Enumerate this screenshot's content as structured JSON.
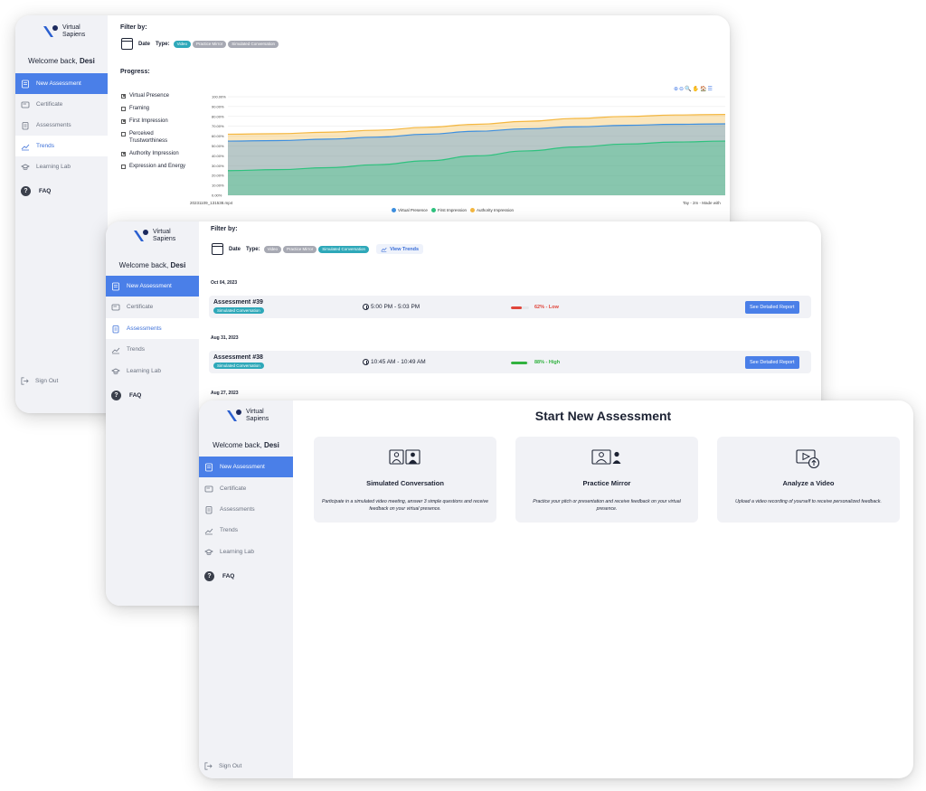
{
  "brand": {
    "line1": "Virtual",
    "line2": "Sapiens"
  },
  "welcome": {
    "prefix": "Welcome back,",
    "name": "Desi"
  },
  "nav": {
    "new_assessment": "New Assessment",
    "certificate": "Certificate",
    "assessments": "Assessments",
    "trends": "Trends",
    "learning_lab": "Learning Lab",
    "faq": "FAQ",
    "sign_out": "Sign Out"
  },
  "filter": {
    "label": "Filter by:",
    "date": "Date",
    "type": "Type:",
    "chips": [
      "Video",
      "Practice Mirror",
      "Simulated Conversation"
    ],
    "view_trends": "View Trends"
  },
  "trends": {
    "progress_label": "Progress:",
    "checklist": [
      {
        "label": "Virtual Presence",
        "checked": true
      },
      {
        "label": "Framing",
        "checked": false
      },
      {
        "label": "First Impression",
        "checked": true
      },
      {
        "label": "Perceived Trustworthiness",
        "checked": false
      },
      {
        "label": "Authority Impression",
        "checked": true
      },
      {
        "label": "Expression and Energy",
        "checked": false
      }
    ],
    "x_label_left": "20231109_131538.mp4",
    "x_label_right": "Tay - 2m - Made with",
    "toolbar_glyphs": "⊕⊖🔍✋🏠☰"
  },
  "chart_data": {
    "type": "area",
    "ylim": [
      0,
      100
    ],
    "yticks": [
      "100.00%",
      "90.00%",
      "80.00%",
      "70.00%",
      "60.00%",
      "50.00%",
      "40.00%",
      "30.00%",
      "20.00%",
      "10.00%",
      "0.00%"
    ],
    "x": [
      0,
      1,
      2,
      3,
      4,
      5,
      6,
      7,
      8,
      9,
      10
    ],
    "series": [
      {
        "name": "Virtual Presence",
        "color": "#3d8fe0",
        "values": [
          55,
          55.5,
          57,
          59,
          62,
          65,
          67.5,
          69.5,
          71,
          72,
          72.5
        ]
      },
      {
        "name": "First Impression",
        "color": "#2ec27e",
        "values": [
          25,
          26,
          28,
          31,
          35,
          40,
          45,
          49,
          52,
          54,
          55
        ]
      },
      {
        "name": "Authority Impression",
        "color": "#f4b740",
        "values": [
          62,
          62.5,
          64,
          66,
          69,
          72,
          75,
          78,
          80,
          81.5,
          82
        ]
      }
    ]
  },
  "assessments": [
    {
      "date": "Oct 04, 2023",
      "title": "Assessment #39",
      "type": "Simulated Conversation",
      "time": "5:00 PM - 5:03 PM",
      "score": "62% - Low",
      "score_pct": 62,
      "score_color": "#e0453a",
      "button": "See Detailed Report"
    },
    {
      "date": "Aug 31, 2023",
      "title": "Assessment #38",
      "type": "Simulated Conversation",
      "time": "10:45 AM - 10:49 AM",
      "score": "88% - High",
      "score_pct": 88,
      "score_color": "#31b23f",
      "button": "See Detailed Report"
    },
    {
      "date": "Aug 27, 2023"
    }
  ],
  "start": {
    "title": "Start New Assessment",
    "cards": [
      {
        "icon": "simulated-conversation-icon",
        "title": "Simulated Conversation",
        "desc": "Participate in a simulated video meeting, answer 3 simple questions and receive feedback on your virtual presence."
      },
      {
        "icon": "practice-mirror-icon",
        "title": "Practice Mirror",
        "desc": "Practice your pitch or presentation and receive feedback on your virtual presence."
      },
      {
        "icon": "analyze-video-icon",
        "title": "Analyze a Video",
        "desc": "Upload a video recording of yourself to receive personalized feedback."
      }
    ]
  }
}
